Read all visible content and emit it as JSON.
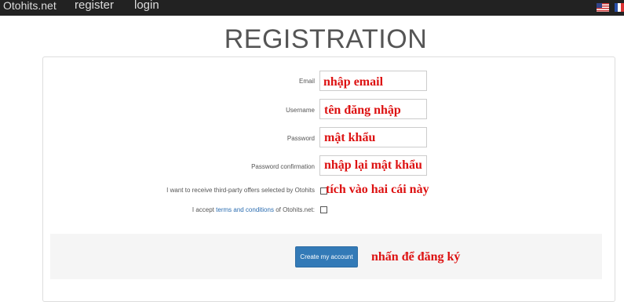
{
  "topbar": {
    "brand": "Otohits.net",
    "nav": [
      "register",
      "login"
    ],
    "flags": [
      "us-flag",
      "fr-flag"
    ]
  },
  "page_title": "REGISTRATION",
  "form": {
    "email_label": "Email",
    "username_label": "Username",
    "password_label": "Password",
    "password_confirmation_label": "Password confirmation",
    "offers_label": "I want to receive third-party offers selected by Otohits",
    "accept_prefix": "I accept ",
    "accept_link": "terms and conditions",
    "accept_suffix": " of Otohits.net:",
    "submit_label": "Create my account"
  },
  "annotations": {
    "email": "nhập email",
    "username": "tên đăng nhập",
    "password": "mật khẩu",
    "password_confirmation": "nhập lại mật khẩu",
    "checkboxes": "tích vào hai cái này",
    "submit": "nhấn để đăng ký"
  },
  "colors": {
    "topbar": "#222222",
    "button": "#337ab7",
    "annotation": "#dd1111",
    "link": "#2a6cb0"
  }
}
